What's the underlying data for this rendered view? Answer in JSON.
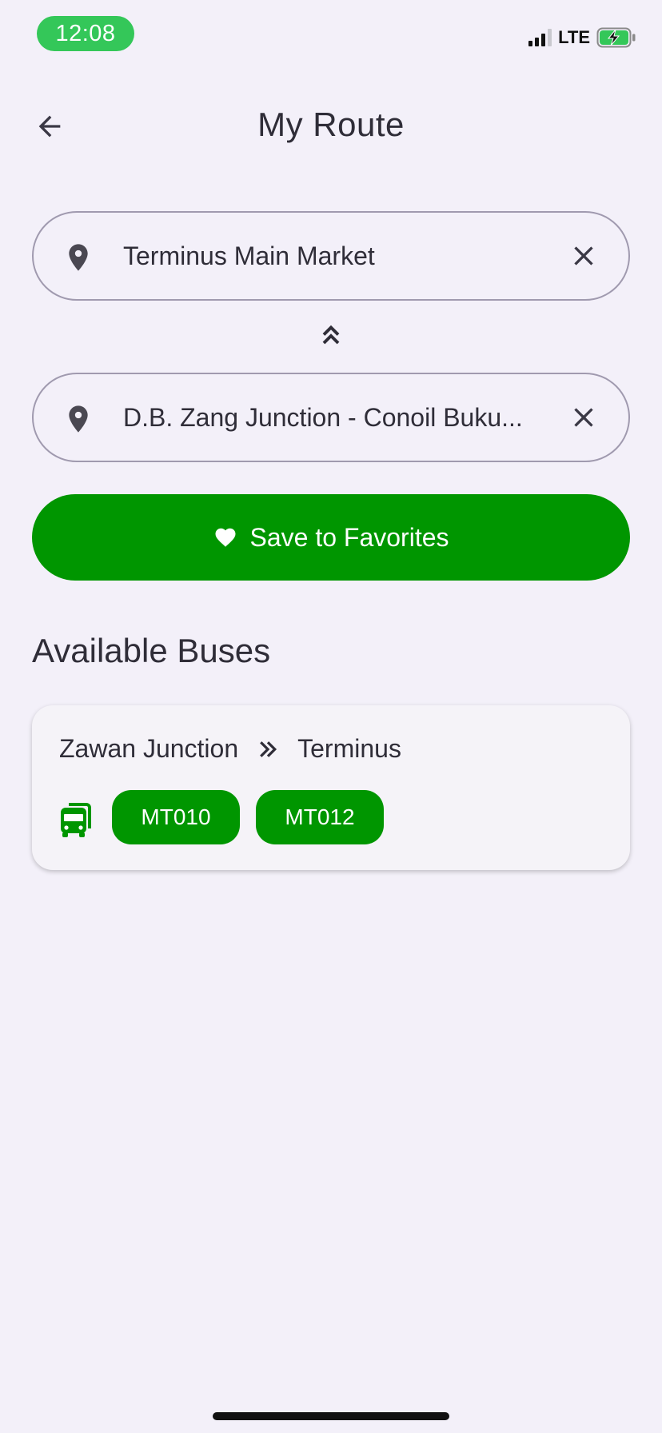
{
  "status_bar": {
    "time": "12:08",
    "network": "LTE",
    "icons": [
      "signal-icon",
      "battery-charging-icon"
    ],
    "time_pill_color": "#34c759"
  },
  "header": {
    "title": "My Route",
    "back_icon": "arrow-left-icon"
  },
  "route_inputs": {
    "from_value": "Terminus Main Market",
    "to_value": "D.B. Zang Junction - Conoil Buku...",
    "pin_icon": "location-pin-icon",
    "clear_icon": "close-icon",
    "swap_icon": "double-chevron-up-icon"
  },
  "save_button": {
    "label": "Save to Favorites",
    "icon": "heart-icon",
    "color": "#009600"
  },
  "available_buses": {
    "title": "Available Buses",
    "routes": [
      {
        "from": "Zawan Junction",
        "to": "Terminus",
        "bus_codes": [
          "MT010",
          "MT012"
        ]
      }
    ]
  },
  "colors": {
    "background": "#f3f0f9",
    "accent_green": "#009600",
    "text": "#2f2d38"
  }
}
